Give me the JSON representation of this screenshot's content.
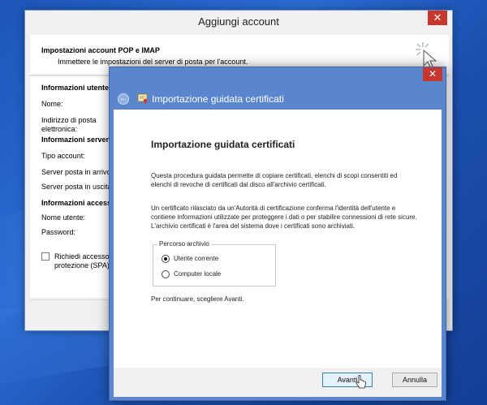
{
  "colors": {
    "close": "#c7372f",
    "wizard_frame": "#5b86cd",
    "desktop": "#1d56b8"
  },
  "account_window": {
    "title": "Aggiungi account",
    "header_title": "Impostazioni account POP e IMAP",
    "header_subtitle": "Immettere le impostazioni del server di posta per l'account.",
    "labels": {
      "user_info": "Informazioni utente",
      "name": "Nome:",
      "email_l1": "Indirizzo di posta",
      "email_l2": "elettronica:",
      "server_info": "Informazioni server",
      "account_type": "Tipo account:",
      "incoming": "Server posta in arrivo",
      "outgoing": "Server posta in uscita",
      "access_info": "Informazioni accesso",
      "username": "Nome utente:",
      "password": "Password:",
      "spa_l1": "Richiedi accesso c",
      "spa_l2": "protezione (SPA)"
    },
    "close_glyph": "✕"
  },
  "wizard": {
    "nav_title": "Importazione guidata certificati",
    "heading": "Importazione guidata certificati",
    "para1": "Questa procedura guidata permette di copiare certificati, elenchi di scopi consentiti ed elenchi di revoche di certificati dal disco all'archivio certificati.",
    "para2": "Un certificato rilasciato da un'Autorità di certificazione conferma l'identità dell'utente e contiene informazioni utilizzate per proteggere i dati o per stabilire connessioni di rete sicure. L'archivio certificati è l'area del sistema dove i certificati sono archiviati.",
    "store_group": "Percorso archivio",
    "option_current": "Utente corrente",
    "option_local": "Computer locale",
    "selected": "Utente corrente",
    "continue_text": "Per continuare, scegliere Avanti.",
    "next_button": "Avanti",
    "cancel_button": "Annulla",
    "close_glyph": "✕",
    "back_glyph": "←"
  }
}
